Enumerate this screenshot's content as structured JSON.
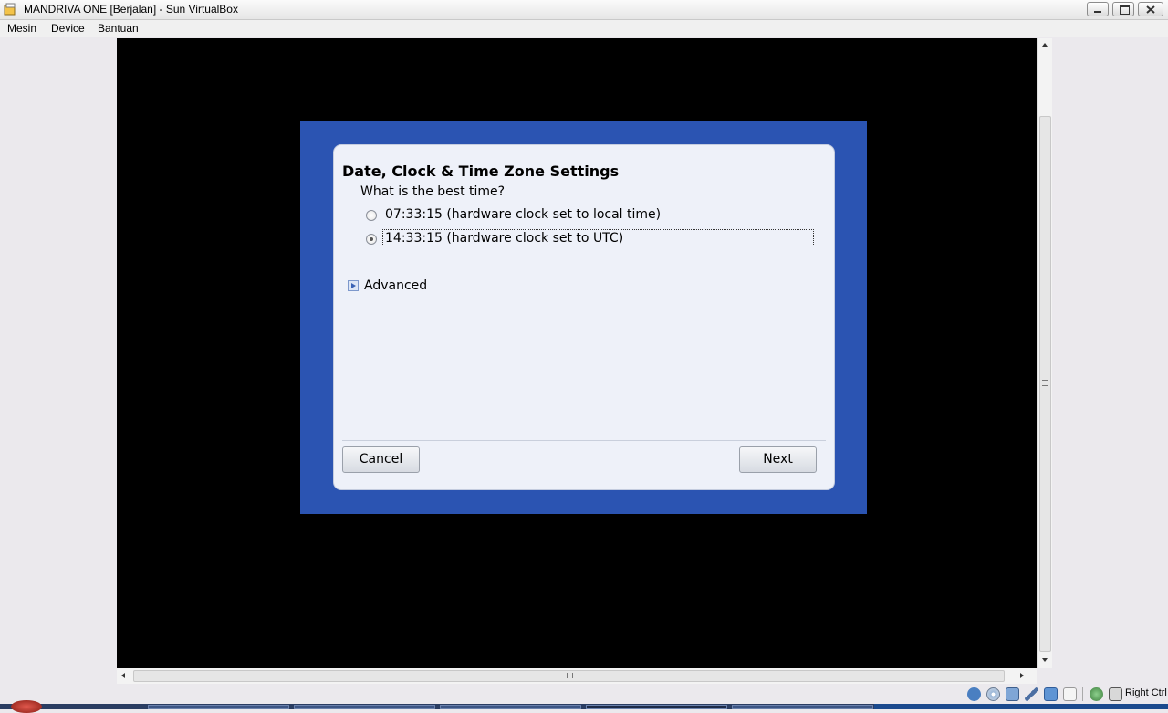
{
  "window": {
    "title": "MANDRIVA ONE [Berjalan] - Sun VirtualBox"
  },
  "menu": {
    "items": [
      {
        "label": "Mesin"
      },
      {
        "label": "Device"
      },
      {
        "label": "Bantuan"
      }
    ]
  },
  "dialog": {
    "title": "Date, Clock & Time Zone Settings",
    "question": "What is the best time?",
    "options": [
      {
        "label": "07:33:15 (hardware clock set to local time)",
        "checked": false
      },
      {
        "label": "14:33:15 (hardware clock set to UTC)",
        "checked": true
      }
    ],
    "advanced_label": "Advanced",
    "cancel_label": "Cancel",
    "next_label": "Next"
  },
  "statusbar": {
    "host_key": "Right Ctrl",
    "icons": [
      "hard-disk-icon",
      "cd-icon",
      "network-icon",
      "usb-icon",
      "shared-folder-icon",
      "display-icon",
      "mouse-integration-icon",
      "host-key-icon"
    ]
  },
  "colors": {
    "frame_blue": "#2b54b2",
    "dialog_bg": "#eef1f9"
  }
}
